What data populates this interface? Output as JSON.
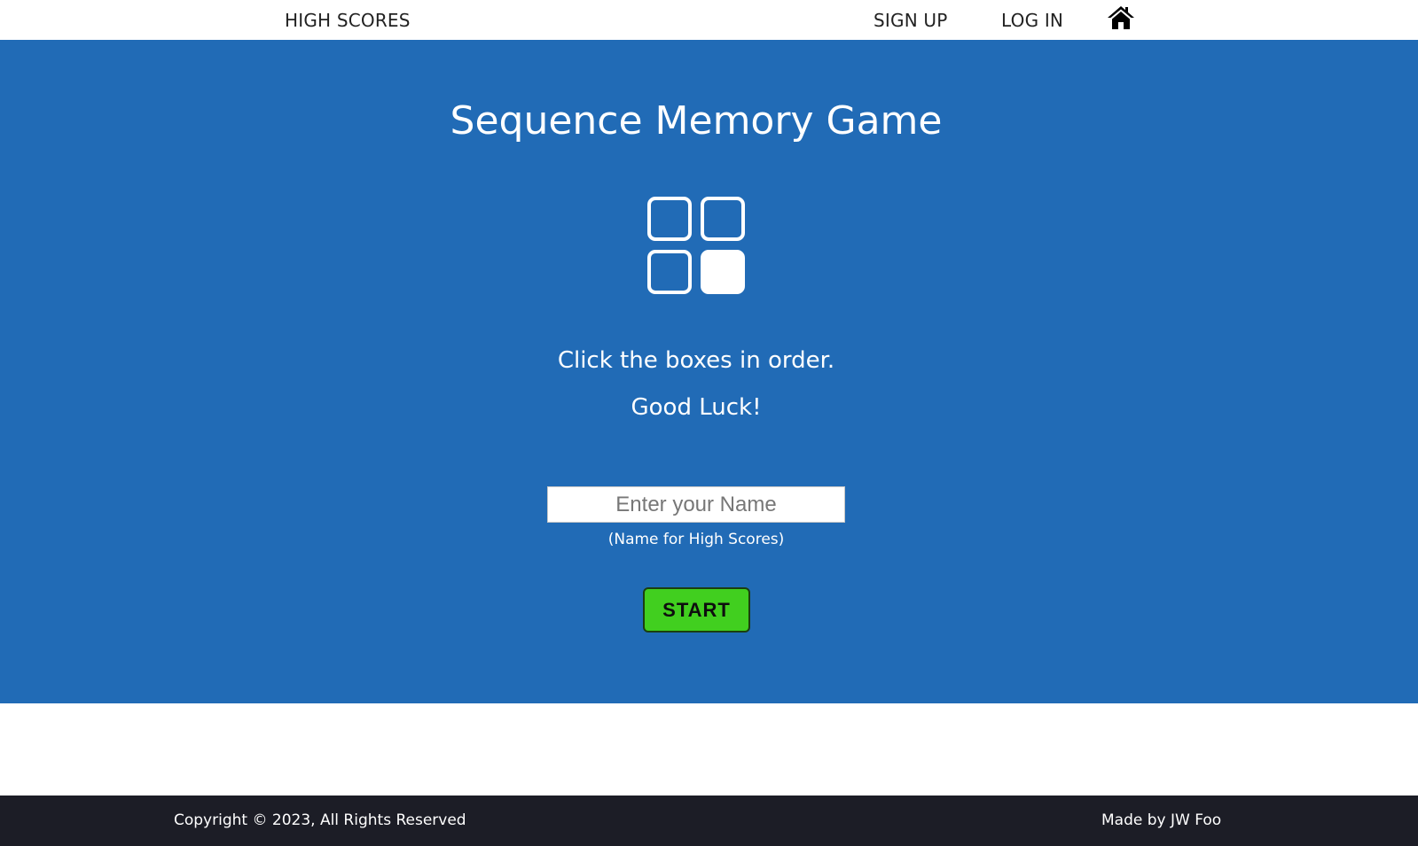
{
  "nav": {
    "high_scores": "HIGH SCORES",
    "sign_up": "SIGN UP",
    "log_in": "LOG IN",
    "home_icon": "home-icon"
  },
  "hero": {
    "title": "Sequence Memory Game",
    "logo_icon": "grid-2x2-icon",
    "instruction_line1": "Click the boxes in order.",
    "instruction_line2": "Good Luck!",
    "name_input": {
      "value": "",
      "placeholder": "Enter your Name"
    },
    "name_hint": "(Name for High Scores)",
    "start_label": "START"
  },
  "colors": {
    "hero_background": "#216bb6",
    "start_button": "#41cf1f",
    "footer_background": "#1c1d26"
  },
  "footer": {
    "copyright": "Copyright © 2023, All Rights Reserved",
    "credit": "Made by JW Foo"
  }
}
